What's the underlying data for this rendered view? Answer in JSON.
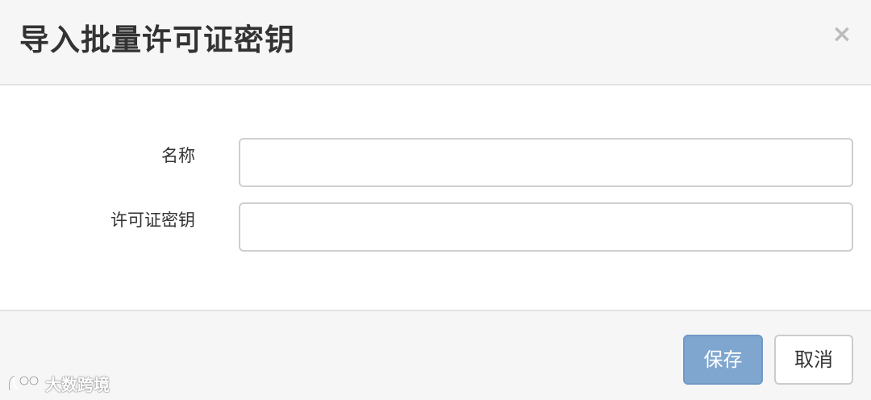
{
  "dialog": {
    "title": "导入批量许可证密钥",
    "close_glyph": "×"
  },
  "form": {
    "name_label": "名称",
    "name_value": "",
    "key_label": "许可证密钥",
    "key_value": ""
  },
  "footer": {
    "save_label": "保存",
    "cancel_label": "取消"
  },
  "watermark": {
    "text": "大数跨境",
    "icon": "brand-logo-icon"
  },
  "colors": {
    "primary_button": "#7fa6cf",
    "header_bg": "#f6f6f6",
    "border": "#cfcfcf"
  }
}
